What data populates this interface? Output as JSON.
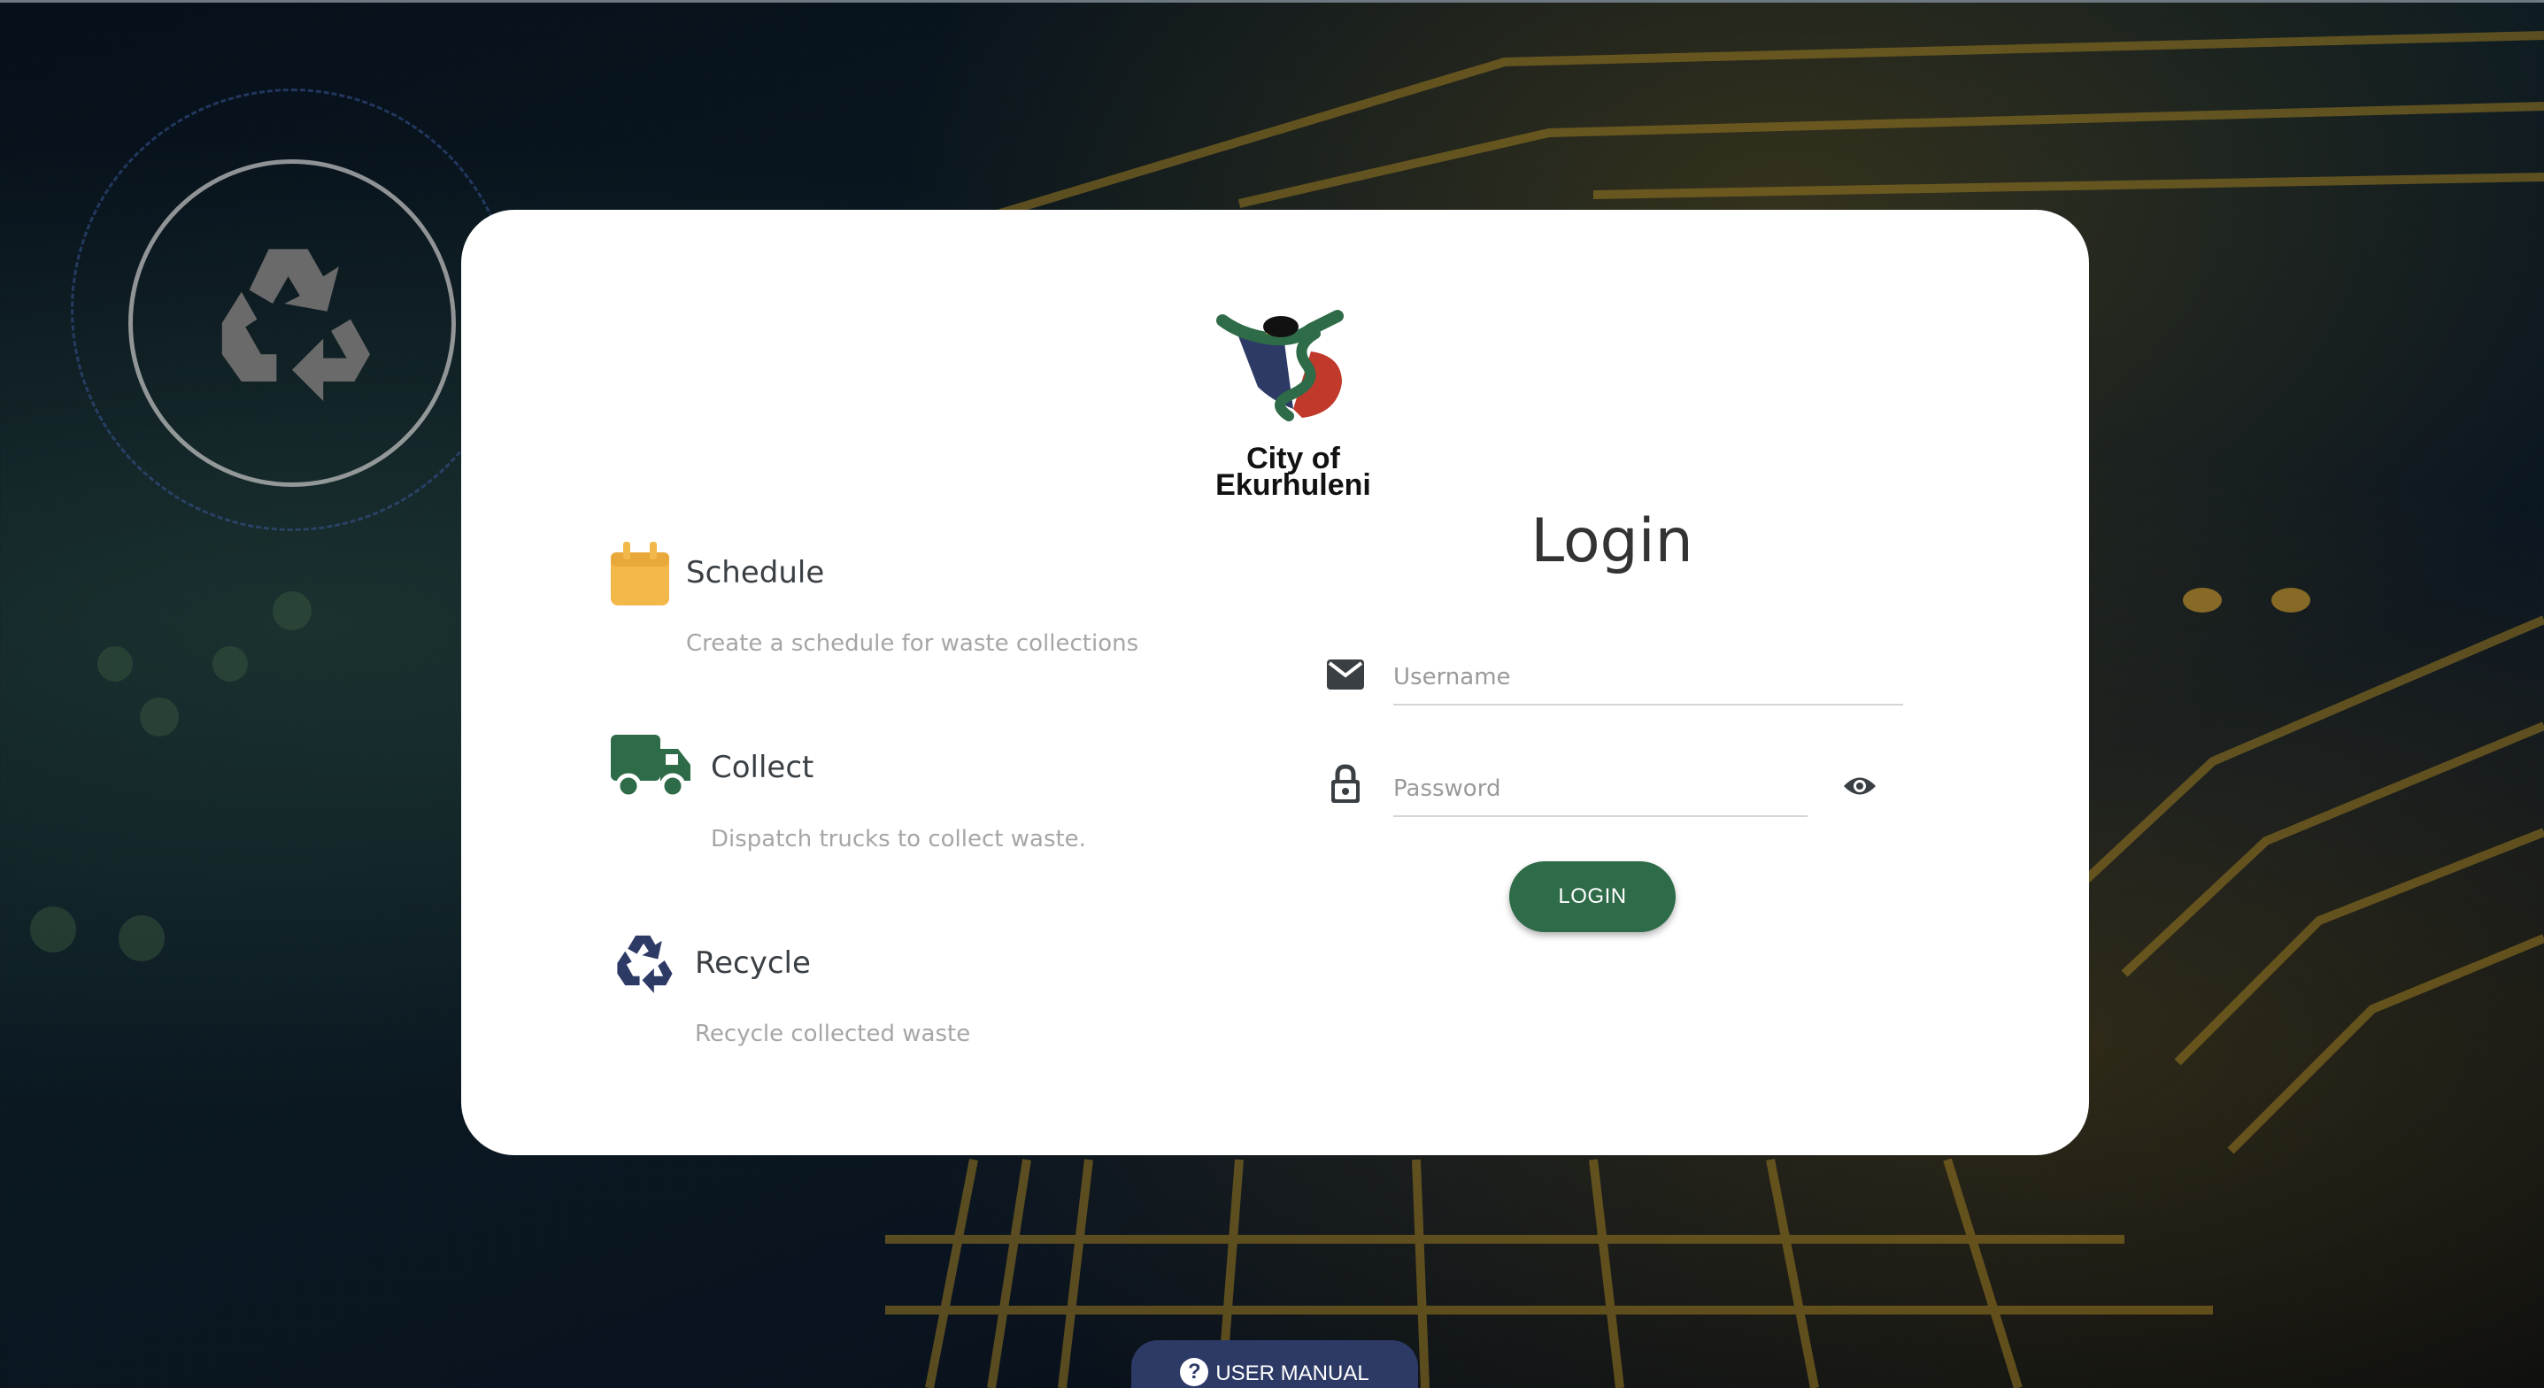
{
  "brand": {
    "logo_line1": "City of",
    "logo_line2": "Ekurhuleni"
  },
  "features": [
    {
      "icon": "calendar-icon",
      "title": "Schedule",
      "description": "Create a schedule for waste collections",
      "color": "#f3b84a"
    },
    {
      "icon": "truck-icon",
      "title": "Collect",
      "description": "Dispatch trucks to collect waste.",
      "color": "#2e6b48"
    },
    {
      "icon": "recycle-icon",
      "title": "Recycle",
      "description": "Recycle collected waste",
      "color": "#2d3a66"
    }
  ],
  "login": {
    "title": "Login",
    "username_placeholder": "Username",
    "username_value": "",
    "password_placeholder": "Password",
    "password_value": "",
    "button_label": "LOGIN"
  },
  "footer": {
    "manual_label": "USER MANUAL"
  },
  "colors": {
    "primary_green": "#2e6b48",
    "navy": "#2d3a66",
    "accent_yellow": "#f3b84a"
  }
}
